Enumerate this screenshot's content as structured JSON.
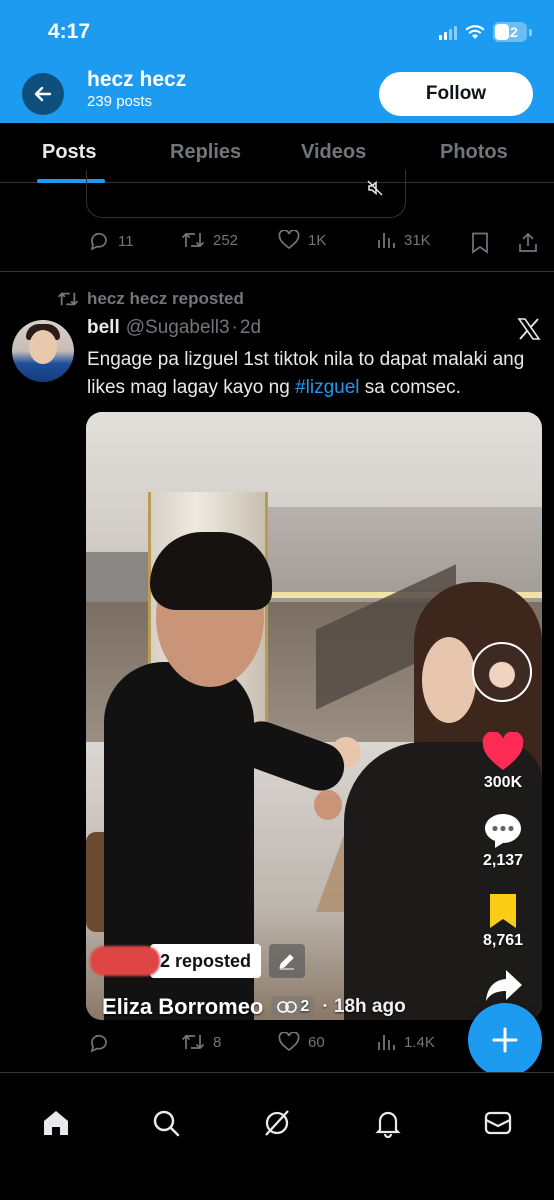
{
  "status_bar": {
    "time": "4:17",
    "battery": "12"
  },
  "header": {
    "name": "hecz hecz",
    "posts_count": "239 posts",
    "follow_label": "Follow"
  },
  "tabs": [
    {
      "label": "Posts",
      "active": true
    },
    {
      "label": "Replies",
      "active": false
    },
    {
      "label": "Videos",
      "active": false
    },
    {
      "label": "Photos",
      "active": false
    }
  ],
  "previous_post": {
    "stats": {
      "replies": "11",
      "reposts": "252",
      "likes": "1K",
      "views": "31K"
    }
  },
  "repost": {
    "reposted_by": "hecz hecz reposted",
    "author_name": "bell",
    "author_handle": "@Sugabell3",
    "separator": "·",
    "time": "2d",
    "text_before": "Engage pa lizguel 1st tiktok nila to dapat malaki ang likes mag lagay kayo ng ",
    "hashtag": "#lizguel",
    "text_after": " sa comsec.",
    "video_overlay": {
      "likes": "300K",
      "comments": "2,137",
      "saves": "8,761",
      "reposted_label": "2 reposted",
      "user_name": "Eliza Borromeo",
      "collab_count": "2",
      "time_ago": "· 18h ago"
    },
    "stats": {
      "replies": "",
      "reposts": "8",
      "likes": "60",
      "views": "1.4K"
    }
  },
  "colors": {
    "accent": "#1d9bf0",
    "background": "#000000",
    "muted": "#71767b",
    "like_red": "#fe2c55",
    "save_yellow": "#facc15"
  },
  "icons": {
    "bottom_nav": [
      "home-icon",
      "search-icon",
      "grok-icon",
      "notifications-icon",
      "messages-icon"
    ]
  }
}
